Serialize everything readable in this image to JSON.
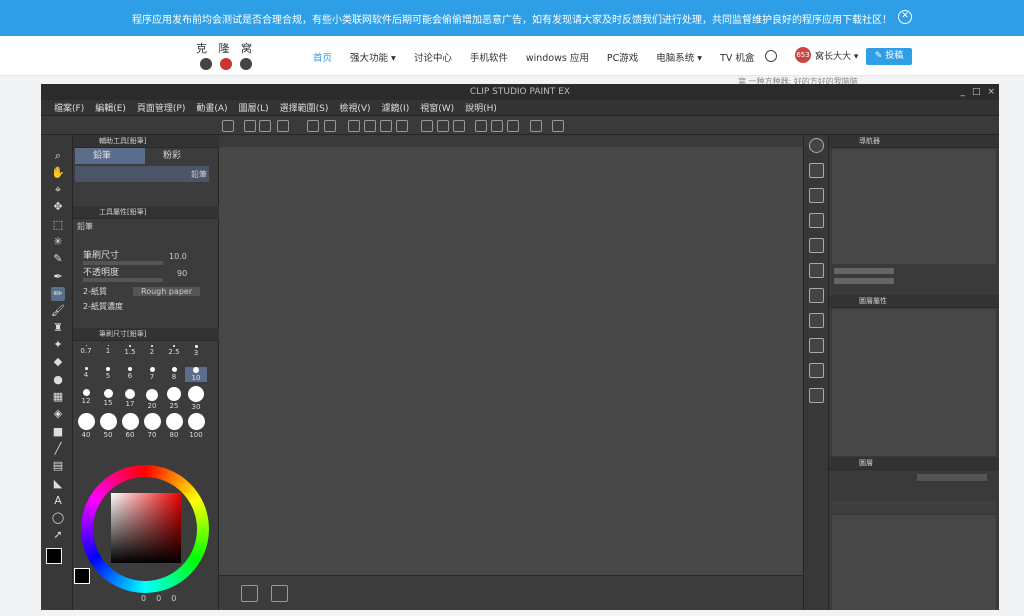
{
  "notice": {
    "text": "程序应用发布前均会测试是否合理合规，有些小类联网软件后期可能会偷偷增加恶意广告，如有发现请大家及时反馈我们进行处理，共同监督维护良好的程序应用下载社区！",
    "close_icon": "close-circle-icon"
  },
  "site": {
    "logo_text": "克 隆 窝",
    "nav": [
      "首页",
      "强大功能 ▾",
      "讨论中心",
      "手机软件",
      "windows 应用",
      "PC游戏",
      "电脑系统 ▾",
      "TV 机盒"
    ],
    "user_name": "窝长大大 ▾",
    "user_badge": "653",
    "post_button": "✎ 投稿",
    "bg_text": "窝 一种方种器; 好的方好的我脑脑"
  },
  "app": {
    "title": "CLIP STUDIO PAINT EX",
    "window_controls": [
      "_",
      "□",
      "×"
    ],
    "menu": [
      "檔案(F)",
      "編輯(E)",
      "頁面管理(P)",
      "動畫(A)",
      "圖層(L)",
      "選擇範圍(S)",
      "檢視(V)",
      "濾鏡(I)",
      "視窗(W)",
      "說明(H)"
    ],
    "sub_tool_panel": {
      "header": "輔助工具[鉛筆]",
      "tabs": [
        "鉛筆",
        "粉彩"
      ],
      "brush_label": "鉛筆"
    },
    "tool_property": {
      "header": "工具屬性[鉛筆]",
      "brush_name": "鉛筆",
      "props": [
        {
          "label": "筆刷尺寸",
          "value": "10.0"
        },
        {
          "label": "不透明度",
          "value": "90"
        },
        {
          "label": "2-紙質",
          "value": "Rough paper"
        },
        {
          "label": "2-紙質濃度",
          "value": ""
        }
      ]
    },
    "brush_size_panel": {
      "header": "筆刷尺寸[鉛筆]",
      "sizes": [
        "0.7",
        "1",
        "1.5",
        "2",
        "2.5",
        "3",
        "4",
        "5",
        "6",
        "7",
        "8",
        "10",
        "12",
        "15",
        "17",
        "20",
        "25",
        "30",
        "40",
        "50",
        "60",
        "70",
        "80",
        "100"
      ],
      "selected": "10"
    },
    "color_panel": {
      "readout": [
        "0",
        "0",
        "0"
      ],
      "fg_color": "#000000",
      "bg_color": "#ffffff"
    },
    "navigator_header": "導航器",
    "layer_property_header": "圖層屬性",
    "layer_header": "圖層"
  },
  "colors": {
    "accent": "#2e9fe6",
    "app_bg": "#3b3b3b",
    "selected": "#5a6e8c"
  }
}
